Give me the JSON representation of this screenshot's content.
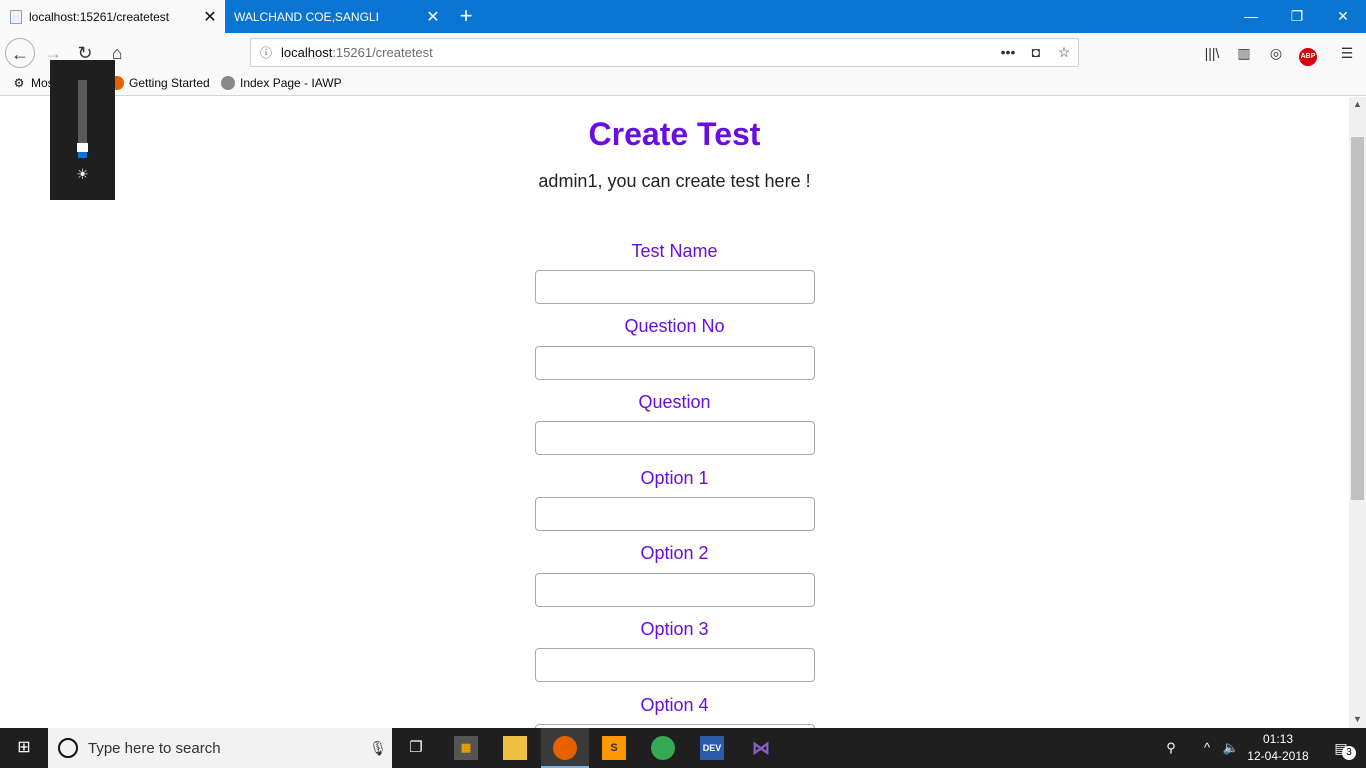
{
  "browser": {
    "tabs": [
      {
        "title": "localhost:15261/createtest",
        "active": true
      },
      {
        "title": "WALCHAND COE,SANGLI",
        "active": false
      }
    ],
    "url_host": "localhost",
    "url_path": ":15261/createtest",
    "bookmarks": [
      {
        "label": "Most Visited",
        "icon": "gear-icon"
      },
      {
        "label": "Getting Started",
        "icon": "firefox-icon"
      },
      {
        "label": "Index Page - IAWP",
        "icon": "globe-icon"
      }
    ]
  },
  "page": {
    "title": "Create Test",
    "subtitle": "admin1, you can create test here !",
    "fields": [
      {
        "label": "Test Name",
        "value": ""
      },
      {
        "label": "Question No",
        "value": ""
      },
      {
        "label": "Question",
        "value": ""
      },
      {
        "label": "Option 1",
        "value": ""
      },
      {
        "label": "Option 2",
        "value": ""
      },
      {
        "label": "Option 3",
        "value": ""
      },
      {
        "label": "Option 4",
        "value": ""
      }
    ],
    "label_color": "#6a0de0"
  },
  "brightness": {
    "level_percent": 5
  },
  "taskbar": {
    "search_placeholder": "Type here to search",
    "time": "01:13",
    "date": "12-04-2018",
    "notification_count": "3"
  },
  "colors": {
    "titlebar": "#0a74d3",
    "accent": "#6a0de0"
  }
}
